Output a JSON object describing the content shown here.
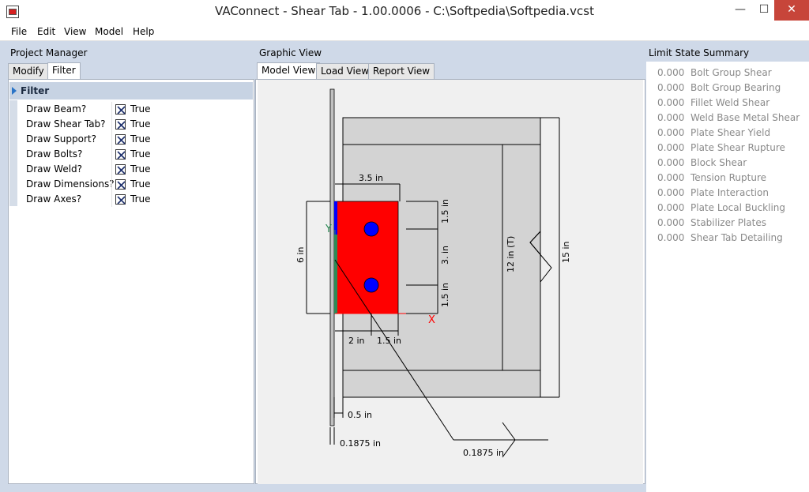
{
  "window": {
    "title": "VAConnect - Shear Tab - 1.00.0006 - C:\\Softpedia\\Softpedia.vcst",
    "minimize": "—",
    "maximize": "☐",
    "close": "✕"
  },
  "menu": [
    "File",
    "Edit",
    "View",
    "Model",
    "Help"
  ],
  "project_manager": {
    "title": "Project Manager",
    "tabs": [
      "Modify",
      "Filter"
    ],
    "active_tab": "Filter",
    "filter_title": "Filter",
    "properties": [
      {
        "label": "Draw Beam?",
        "value": "True",
        "checked": true
      },
      {
        "label": "Draw Shear Tab?",
        "value": "True",
        "checked": true
      },
      {
        "label": "Draw Support?",
        "value": "True",
        "checked": true
      },
      {
        "label": "Draw Bolts?",
        "value": "True",
        "checked": true
      },
      {
        "label": "Draw Weld?",
        "value": "True",
        "checked": true
      },
      {
        "label": "Draw Dimensions?",
        "value": "True",
        "checked": true
      },
      {
        "label": "Draw Axes?",
        "value": "True",
        "checked": true
      }
    ]
  },
  "graphic_view": {
    "title": "Graphic View",
    "tabs": [
      "Model View",
      "Load View",
      "Report View"
    ],
    "active_tab": "Model View",
    "drawing": {
      "dim_3_5": "3.5 in",
      "dim_1_5_top": "1.5 in",
      "dim_3": "3. in",
      "dim_1_5_bottom": "1.5 in",
      "dim_6": "6 in",
      "dim_2": "2 in",
      "dim_1_5_horiz": "1.5 in",
      "dim_12": "12 in (T)",
      "dim_15": "15 in",
      "dim_0_5": "0.5 in",
      "dim_0_1875_support": "0.1875 in",
      "dim_0_1875_weld": "0.1875 in",
      "axis_x": "X",
      "axis_y": "Y",
      "colors": {
        "plate": "#ff0000",
        "bolt": "#0000ff",
        "beam": "#d3d3d3",
        "support": "#c0c0c0",
        "weld_blue": "#0000ff",
        "weld_green": "#2e8b57",
        "axis_x": "#ff0000",
        "axis_y": "#2e8b57"
      }
    }
  },
  "limit_state_summary": {
    "title": "Limit State Summary",
    "rows": [
      {
        "value": "0.000",
        "name": "Bolt Group Shear"
      },
      {
        "value": "0.000",
        "name": "Bolt Group Bearing"
      },
      {
        "value": "0.000",
        "name": "Fillet Weld Shear"
      },
      {
        "value": "0.000",
        "name": "Weld Base Metal Shear"
      },
      {
        "value": "0.000",
        "name": "Plate Shear Yield"
      },
      {
        "value": "0.000",
        "name": "Plate Shear Rupture"
      },
      {
        "value": "0.000",
        "name": "Block Shear"
      },
      {
        "value": "0.000",
        "name": "Tension Rupture"
      },
      {
        "value": "0.000",
        "name": "Plate Interaction"
      },
      {
        "value": "0.000",
        "name": "Plate Local Buckling"
      },
      {
        "value": "0.000",
        "name": "Stabilizer Plates"
      },
      {
        "value": "0.000",
        "name": "Shear Tab Detailing"
      }
    ]
  }
}
